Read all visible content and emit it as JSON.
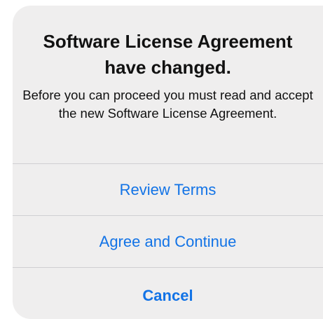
{
  "alert": {
    "title": "Software License Agreement have changed.",
    "message": "Before you can proceed you must read and accept the new Software License Agreement.",
    "actions": {
      "review": "Review Terms",
      "agree": "Agree and Continue",
      "cancel": "Cancel"
    }
  },
  "colors": {
    "alert_background": "#efeeee",
    "button_text": "#1273e6",
    "separator": "#cfcfd2"
  }
}
